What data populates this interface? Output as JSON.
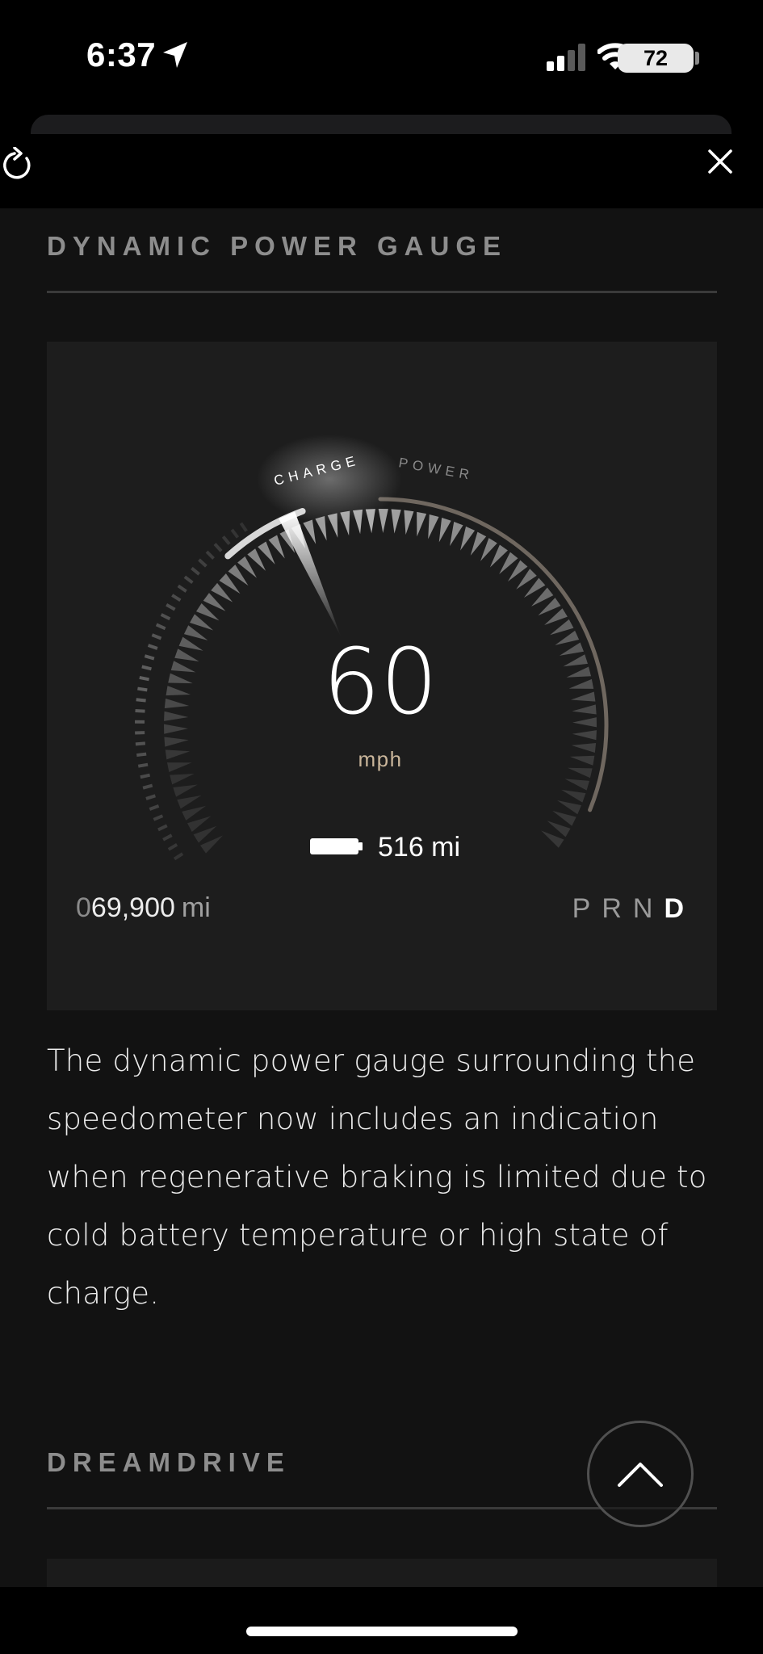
{
  "status_bar": {
    "time": "6:37",
    "battery_percent": "72",
    "signal_bars_active": 2,
    "signal_bars_total": 4
  },
  "toolbar": {
    "refresh_icon": "refresh-icon",
    "close_icon": "close-icon"
  },
  "sections": {
    "gauge_title": "DYNAMIC POWER GAUGE",
    "second_title": "DREAMDRIVE"
  },
  "gauge": {
    "charge_label": "CHARGE",
    "power_label": "POWER",
    "speed": "60",
    "speed_unit": "mph",
    "range": "516 mi",
    "odometer_prefix": "0",
    "odometer_digits": "69,900",
    "odometer_unit": "mi",
    "gears": [
      "P",
      "R",
      "N",
      "D"
    ],
    "active_gear": "D",
    "colors": {
      "charge_highlight": "#ffffff",
      "power_arc": "#6f675f",
      "unit_text": "#c9b59a"
    }
  },
  "description": "The dynamic power gauge surrounding the speedometer now includes an indication when regenerative braking is limited due to cold battery temperature or high state of charge.",
  "scroll_top_icon": "chevron-up-icon"
}
